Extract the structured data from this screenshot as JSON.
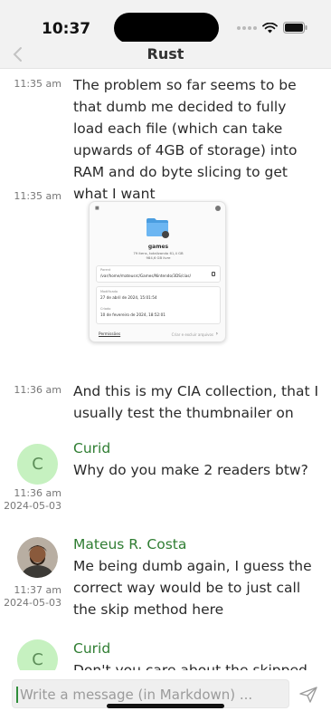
{
  "status_bar": {
    "time": "10:37"
  },
  "nav": {
    "title": "Rust"
  },
  "messages": [
    {
      "time": "11:35 am",
      "text": "The problem so far seems to be that dumb me decided to fully load each file  (which can take upwards of 4GB of storage) into RAM and do byte slicing to get what I want"
    },
    {
      "time": "11:35 am",
      "image": {
        "folder_name": "games",
        "summary": "79 itens, totalizando 61,4 GB",
        "summary2": "984,6 GB livre",
        "path_label": "Parent",
        "path_value": "/var/home/mateusrc/Games/Nintendo/3DS/cias/",
        "modified_label": "Modificado",
        "modified_value": "27 de abril de 2024, 15:01:54",
        "created_label": "Criado",
        "created_value": "10 de fevereiro de 2024, 18:52:01",
        "permissions_label": "Permissões",
        "permissions_hint": "Criar e excluir arquivos"
      }
    },
    {
      "time": "11:36 am",
      "text": "And this is my CIA collection, that I usually test the thumbnailer on"
    },
    {
      "author": "Curid",
      "avatar_letter": "C",
      "time": "11:36 am",
      "date": "2024-05-03",
      "text": "Why do you make 2 readers btw?"
    },
    {
      "author": "Mateus R. Costa",
      "time": "11:37 am",
      "date": "2024-05-03",
      "text": "Me being dumb again, I guess the correct way would be to just call the skip method here"
    },
    {
      "author": "Curid",
      "avatar_letter": "C",
      "text": "Don't you care about the skipped"
    }
  ],
  "composer": {
    "placeholder": "Write a message (in Markdown) ..."
  },
  "colors": {
    "author": "#2f7d32",
    "avatar_bg": "#c6f1c0",
    "caret": "#2f8d3a"
  }
}
